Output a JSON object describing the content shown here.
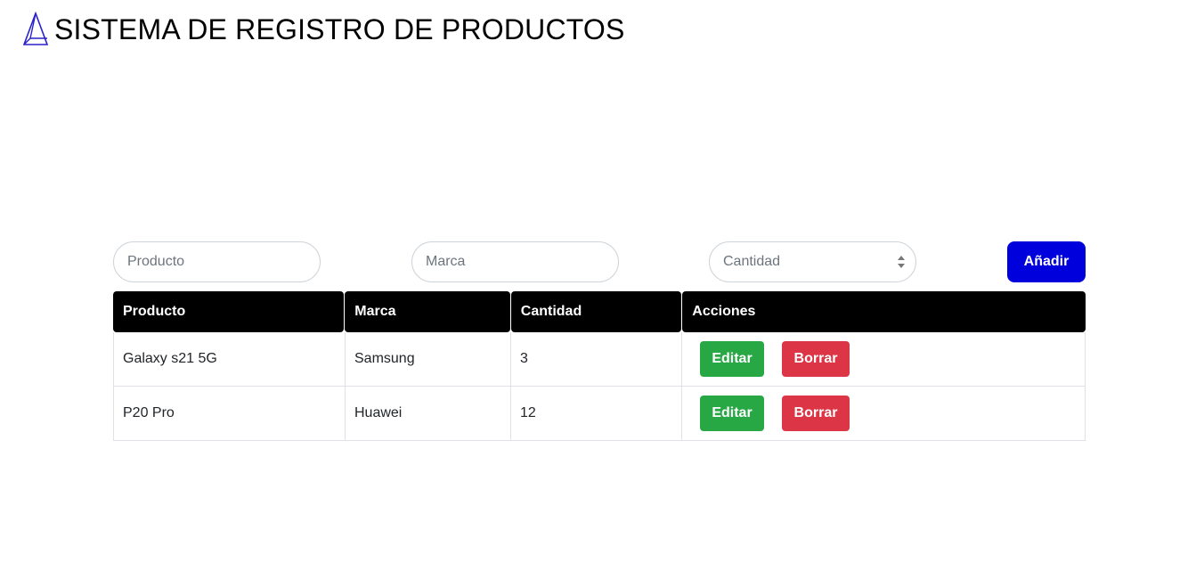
{
  "header": {
    "title": "SISTEMA DE REGISTRO DE PRODUCTOS",
    "logo_icon": "triangle-logo-icon",
    "logo_color": "#2a21c9"
  },
  "form": {
    "producto_placeholder": "Producto",
    "marca_placeholder": "Marca",
    "cantidad_placeholder": "Cantidad",
    "add_label": "Añadir",
    "add_color": "#0000dd"
  },
  "table": {
    "headers": [
      "Producto",
      "Marca",
      "Cantidad",
      "Acciones"
    ],
    "rows": [
      {
        "producto": "Galaxy s21 5G",
        "marca": "Samsung",
        "cantidad": "3",
        "edit_label": "Editar",
        "delete_label": "Borrar"
      },
      {
        "producto": "P20 Pro",
        "marca": "Huawei",
        "cantidad": "12",
        "edit_label": "Editar",
        "delete_label": "Borrar"
      }
    ],
    "edit_color": "#28a745",
    "delete_color": "#dc3545"
  }
}
